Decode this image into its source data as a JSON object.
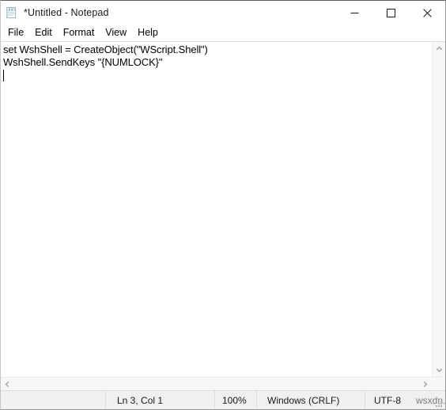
{
  "window": {
    "title": "*Untitled - Notepad",
    "app_icon": "notepad-icon",
    "controls": {
      "minimize": "─",
      "maximize": "□",
      "close": "✕"
    }
  },
  "menubar": {
    "items": [
      {
        "label": "File"
      },
      {
        "label": "Edit"
      },
      {
        "label": "Format"
      },
      {
        "label": "View"
      },
      {
        "label": "Help"
      }
    ]
  },
  "editor": {
    "lines": [
      "set WshShell = CreateObject(\"WScript.Shell\")",
      "WshShell.SendKeys \"{NUMLOCK}\"",
      ""
    ],
    "caret_line": 3,
    "caret_col": 1
  },
  "scrollbars": {
    "vertical": {
      "up_arrow": "⌃",
      "down_arrow": "⌄"
    },
    "horizontal": {
      "left_arrow": "‹",
      "right_arrow": "›"
    }
  },
  "statusbar": {
    "position": "Ln 3, Col 1",
    "zoom": "100%",
    "line_endings": "Windows (CRLF)",
    "encoding": "UTF-8",
    "watermark": "wsxdn.com"
  },
  "colors": {
    "window_bg": "#ffffff",
    "statusbar_bg": "#f0f0f0",
    "scrollbar_bg": "#f7f7f7",
    "text": "#000000",
    "divider": "#dcdcdc",
    "watermark": "#7c7c7c"
  }
}
